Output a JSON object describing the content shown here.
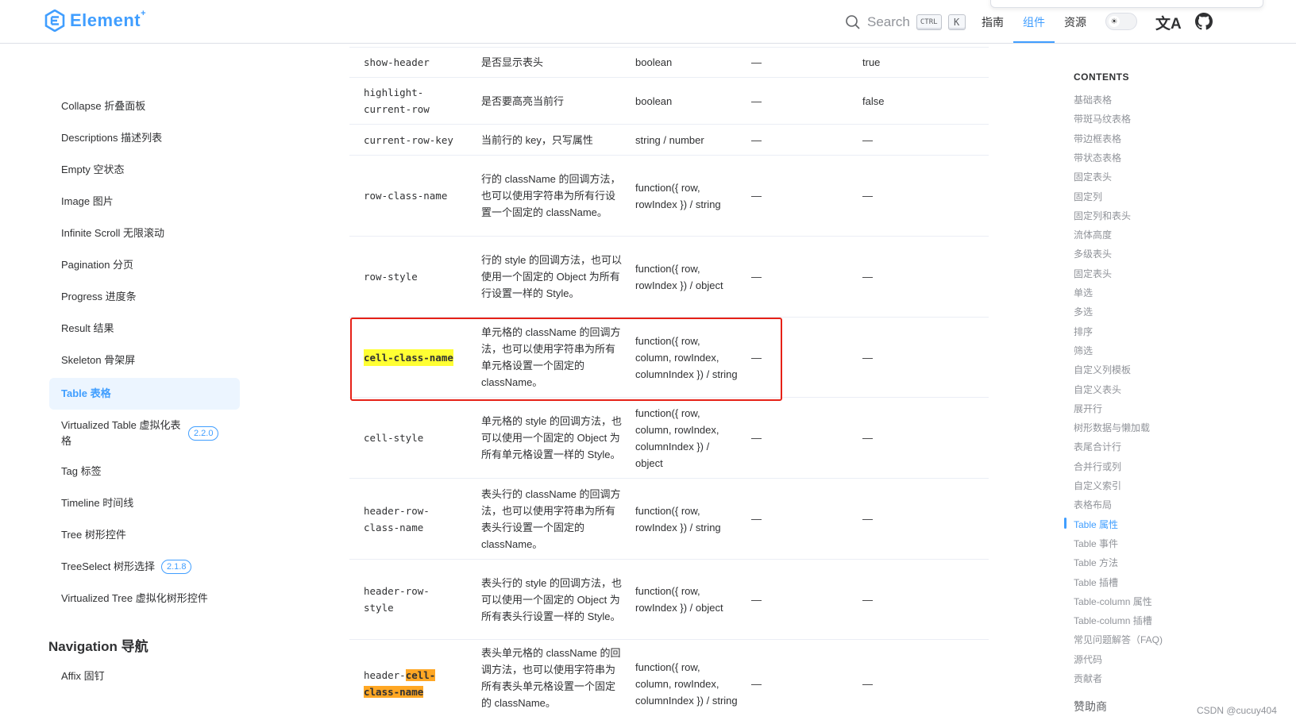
{
  "header": {
    "logo_text": "Element",
    "logo_sup": "+",
    "search_label": "Search",
    "kbd_ctrl": "CTRL",
    "kbd_k": "K",
    "nav": [
      "指南",
      "组件",
      "资源"
    ],
    "lang_glyph": "文A"
  },
  "sidebar": {
    "items": [
      {
        "label": "Collapse 折叠面板"
      },
      {
        "label": "Descriptions 描述列表"
      },
      {
        "label": "Empty 空状态"
      },
      {
        "label": "Image 图片"
      },
      {
        "label": "Infinite Scroll 无限滚动"
      },
      {
        "label": "Pagination 分页"
      },
      {
        "label": "Progress 进度条"
      },
      {
        "label": "Result 结果"
      },
      {
        "label": "Skeleton 骨架屏"
      },
      {
        "label": "Table 表格"
      },
      {
        "label": "Virtualized Table 虚拟化表格",
        "badge": "2.2.0"
      },
      {
        "label": "Tag 标签"
      },
      {
        "label": "Timeline 时间线"
      },
      {
        "label": "Tree 树形控件"
      },
      {
        "label": "TreeSelect 树形选择",
        "badge": "2.1.8"
      },
      {
        "label": "Virtualized Tree 虚拟化树形控件"
      }
    ],
    "group": "Navigation 导航",
    "after_group": [
      "Affix 固钉"
    ]
  },
  "table": {
    "rows": [
      {
        "name": "show-header",
        "desc": "是否显示表头",
        "type": "boolean",
        "acc": "—",
        "def": "true"
      },
      {
        "name": "highlight-current-row",
        "desc": "是否要高亮当前行",
        "type": "boolean",
        "acc": "—",
        "def": "false"
      },
      {
        "name": "current-row-key",
        "desc": "当前行的 key，只写属性",
        "type": "string / number",
        "acc": "—",
        "def": "—"
      },
      {
        "name": "row-class-name",
        "desc": "行的 className 的回调方法，也可以使用字符串为所有行设置一个固定的 className。",
        "type": "function({ row, rowIndex }) / string",
        "acc": "—",
        "def": "—"
      },
      {
        "name": "row-style",
        "desc": "行的 style 的回调方法，也可以使用一个固定的 Object 为所有行设置一样的 Style。",
        "type": "function({ row, rowIndex }) / object",
        "acc": "—",
        "def": "—"
      },
      {
        "name": "cell-class-name",
        "desc": "单元格的 className 的回调方法，也可以使用字符串为所有单元格设置一个固定的 className。",
        "type": "function({ row, column, rowIndex, columnIndex }) / string",
        "acc": "—",
        "def": "—"
      },
      {
        "name": "cell-style",
        "desc": "单元格的 style 的回调方法，也可以使用一个固定的 Object 为所有单元格设置一样的 Style。",
        "type": "function({ row, column, rowIndex, columnIndex }) / object",
        "acc": "—",
        "def": "—"
      },
      {
        "name": "header-row-class-name",
        "desc": "表头行的 className 的回调方法，也可以使用字符串为所有表头行设置一个固定的 className。",
        "type": "function({ row, rowIndex }) / string",
        "acc": "—",
        "def": "—"
      },
      {
        "name": "header-row-style",
        "desc": "表头行的 style 的回调方法，也可以使用一个固定的 Object 为所有表头行设置一样的 Style。",
        "type": "function({ row, rowIndex }) / object",
        "acc": "—",
        "def": "—"
      },
      {
        "name_prefix": "header-",
        "name_hl": "cell-class-name",
        "desc": "表头单元格的 className 的回调方法，也可以使用字符串为所有表头单元格设置一个固定的 className。",
        "type": "function({ row, column, rowIndex, columnIndex }) / string",
        "acc": "—",
        "def": "—"
      }
    ]
  },
  "toc": {
    "title": "CONTENTS",
    "items": [
      "基础表格",
      "带斑马纹表格",
      "带边框表格",
      "带状态表格",
      "固定表头",
      "固定列",
      "固定列和表头",
      "流体高度",
      "多级表头",
      "固定表头",
      "单选",
      "多选",
      "排序",
      "筛选",
      "自定义列模板",
      "自定义表头",
      "展开行",
      "树形数据与懒加载",
      "表尾合计行",
      "合并行或列",
      "自定义索引",
      "表格布局",
      "Table 属性",
      "Table 事件",
      "Table 方法",
      "Table 插槽",
      "Table-column 属性",
      "Table-column 插槽",
      "常见问题解答（FAQ)",
      "源代码",
      "贡献者"
    ],
    "active_index": 22,
    "sponsor": "赞助商"
  },
  "watermark": "CSDN @cucuy404",
  "colors": {
    "accent": "#409eff",
    "highlight_yellow": "#ffff33",
    "highlight_orange": "#ffa724",
    "annotation_red": "#e62117"
  }
}
